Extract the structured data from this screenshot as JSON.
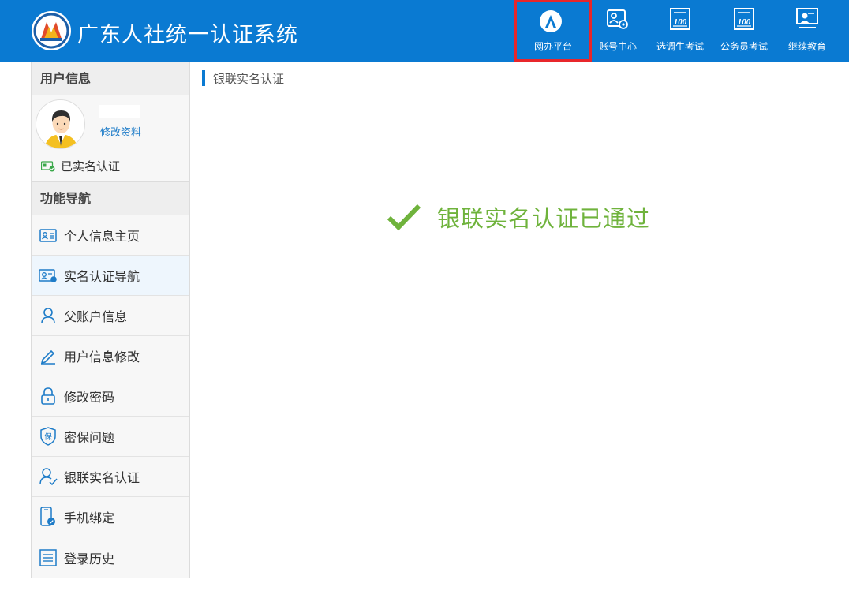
{
  "header": {
    "title": "广东人社统一认证系统",
    "nav": [
      {
        "label": "网办平台",
        "icon": "portal-icon",
        "active": true
      },
      {
        "label": "账号中心",
        "icon": "account-settings-icon",
        "active": false
      },
      {
        "label": "选调生考试",
        "icon": "exam-100-icon",
        "active": false
      },
      {
        "label": "公务员考试",
        "icon": "exam-100-icon",
        "active": false
      },
      {
        "label": "继续教育",
        "icon": "teacher-board-icon",
        "active": false
      }
    ]
  },
  "sidebar": {
    "user_section": "用户信息",
    "edit_profile": "修改资料",
    "verified_status": "已实名认证",
    "nav_section": "功能导航",
    "menu": [
      {
        "label": "个人信息主页",
        "icon": "id-card-icon"
      },
      {
        "label": "实名认证导航",
        "icon": "verify-card-icon"
      },
      {
        "label": "父账户信息",
        "icon": "user-icon"
      },
      {
        "label": "用户信息修改",
        "icon": "pencil-icon"
      },
      {
        "label": "修改密码",
        "icon": "lock-icon"
      },
      {
        "label": "密保问题",
        "icon": "shield-icon"
      },
      {
        "label": "银联实名认证",
        "icon": "user-check-icon"
      },
      {
        "label": "手机绑定",
        "icon": "phone-icon"
      },
      {
        "label": "登录历史",
        "icon": "list-icon"
      }
    ],
    "selected_index": 1
  },
  "main": {
    "breadcrumb": "银联实名认证",
    "success_message": "银联实名认证已通过"
  },
  "colors": {
    "header_bg": "#0a7ad2",
    "active_border": "#e8262b",
    "success_green": "#6fb33c",
    "link_blue": "#1e7cc8"
  }
}
